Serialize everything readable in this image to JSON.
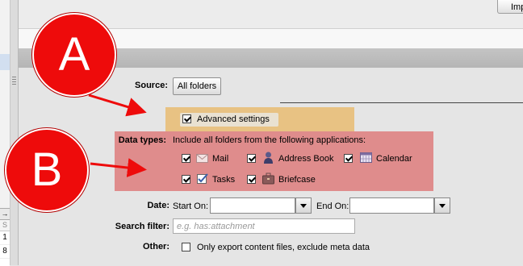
{
  "toolbar": {
    "import_label": "Imp"
  },
  "left_panel": {
    "header_glyph": "→",
    "sub_label": "S",
    "rows": [
      "1",
      "8"
    ]
  },
  "source": {
    "label": "Source:",
    "button_label": "All folders"
  },
  "advanced": {
    "label": "Advanced settings",
    "checked": true
  },
  "data_types": {
    "label": "Data types:",
    "description": "Include all folders from the following applications:",
    "items": [
      {
        "label": "Mail",
        "checked": true,
        "icon": "mail-icon"
      },
      {
        "label": "Address Book",
        "checked": true,
        "icon": "address-book-icon"
      },
      {
        "label": "Calendar",
        "checked": true,
        "icon": "calendar-icon"
      },
      {
        "label": "Tasks",
        "checked": true,
        "icon": "tasks-icon"
      },
      {
        "label": "Briefcase",
        "checked": true,
        "icon": "briefcase-icon"
      }
    ]
  },
  "date": {
    "label": "Date:",
    "start_label": "Start On:",
    "end_label": "End On:"
  },
  "search_filter": {
    "label": "Search filter:",
    "placeholder": "e.g. has:attachment",
    "value": ""
  },
  "other": {
    "label": "Other:",
    "option_label": "Only export content files, exclude meta data",
    "checked": false
  },
  "annotations": {
    "a": "A",
    "b": "B"
  },
  "colors": {
    "callout": "#ee0b0b",
    "advanced_highlight": "#e8c283",
    "data_types_highlight": "#df8c8c"
  }
}
